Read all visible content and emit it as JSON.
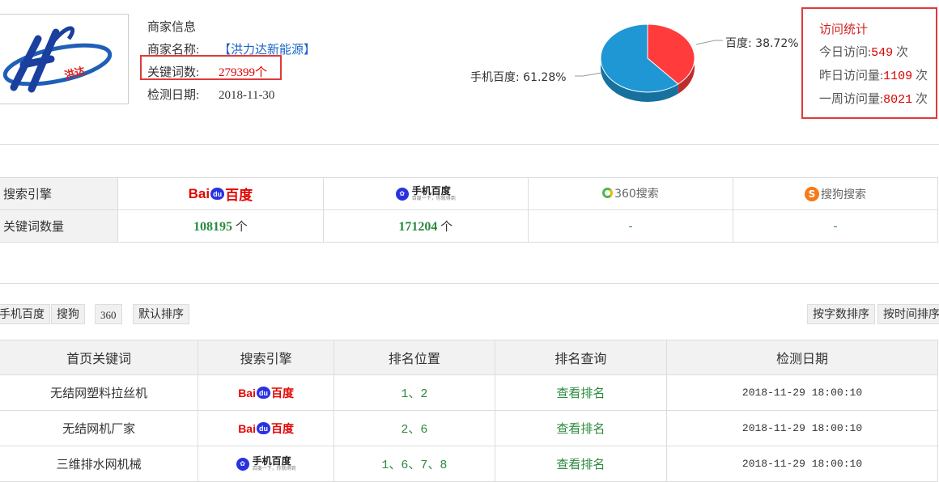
{
  "merchant": {
    "section_label": "商家信息",
    "name_label": "商家名称:",
    "name_value": "【洪力达新能源】",
    "keyword_label": "关键词数:",
    "keyword_value": "279399个",
    "date_label": "检测日期:",
    "date_value": "2018-11-30",
    "logo_text": "洪达"
  },
  "pie": {
    "slices": [
      {
        "label": "百度: 38.72%",
        "value": 38.72,
        "color": "#ff3b3b"
      },
      {
        "label": "手机百度: 61.28%",
        "value": 61.28,
        "color": "#1f97d4"
      }
    ]
  },
  "visit_stats": {
    "title": "访问统计",
    "today_label": "今日访问:",
    "today_value": "549",
    "yesterday_label": "昨日访问量:",
    "yesterday_value": "1109",
    "week_label": "一周访问量:",
    "week_value": "8021",
    "unit": " 次"
  },
  "engine_table": {
    "row1_header": "搜索引擎",
    "row2_header": "关键词数量",
    "engines": [
      {
        "logo": "Bai百度",
        "count": "108195",
        "unit": " 个"
      },
      {
        "logo_title": "手机百度",
        "logo_sub": "百度一下，你就得到",
        "count": "171204",
        "unit": " 个"
      },
      {
        "logo": "360搜索",
        "count": "-"
      },
      {
        "logo": "搜狗搜索",
        "count": "-"
      }
    ]
  },
  "filters": {
    "mobile_baidu": "手机百度",
    "sogou": "搜狗",
    "s360": "360",
    "default_sort": "默认排序",
    "sort_by_chars": "按字数排序",
    "sort_by_time": "按时间排序"
  },
  "rank_table": {
    "headers": [
      "首页关键词",
      "搜索引擎",
      "排名位置",
      "排名查询",
      "检测日期"
    ],
    "rows": [
      {
        "keyword": "无结网塑料拉丝机",
        "engine": "baidu",
        "rank": "1、2",
        "query": "查看排名",
        "date": "2018-11-29 18:00:10"
      },
      {
        "keyword": "无结网机厂家",
        "engine": "baidu",
        "rank": "2、6",
        "query": "查看排名",
        "date": "2018-11-29 18:00:10"
      },
      {
        "keyword": "三维排水网机械",
        "engine": "mobile-baidu",
        "rank": "1、6、7、8",
        "query": "查看排名",
        "date": "2018-11-29 18:00:10"
      }
    ]
  }
}
